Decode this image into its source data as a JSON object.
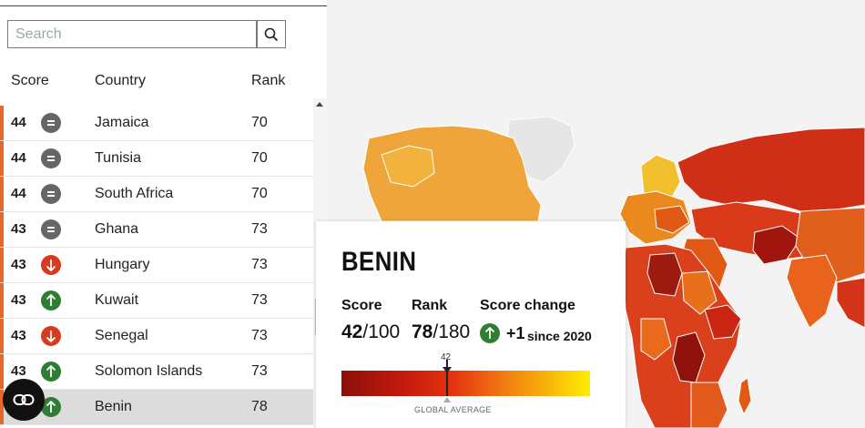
{
  "search": {
    "placeholder": "Search"
  },
  "columns": {
    "score": "Score",
    "country": "Country",
    "rank": "Rank"
  },
  "rows": [
    {
      "score": "44",
      "change": "same",
      "country": "Jamaica",
      "rank": "70"
    },
    {
      "score": "44",
      "change": "same",
      "country": "Tunisia",
      "rank": "70"
    },
    {
      "score": "44",
      "change": "same",
      "country": "South Africa",
      "rank": "70"
    },
    {
      "score": "43",
      "change": "same",
      "country": "Ghana",
      "rank": "73"
    },
    {
      "score": "43",
      "change": "down",
      "country": "Hungary",
      "rank": "73"
    },
    {
      "score": "43",
      "change": "up",
      "country": "Kuwait",
      "rank": "73"
    },
    {
      "score": "43",
      "change": "down",
      "country": "Senegal",
      "rank": "73"
    },
    {
      "score": "43",
      "change": "up",
      "country": "Solomon Islands",
      "rank": "73"
    },
    {
      "score": "",
      "change": "up",
      "country": "Benin",
      "rank": "78",
      "selected": true
    }
  ],
  "colors": {
    "same": "#666666",
    "down": "#d73a1e",
    "up": "#2e7d32",
    "row_bar": "#e8672b"
  },
  "card": {
    "country": "BENIN",
    "score_label": "Score",
    "rank_label": "Rank",
    "change_label": "Score change",
    "score_value": "42",
    "score_total": "/100",
    "rank_value": "78",
    "rank_total": "/180",
    "change_value": "+1",
    "since": "since 2020",
    "marker_value": "42",
    "average_label": "GLOBAL AVERAGE"
  },
  "icons": {
    "search": "search-icon",
    "fab": "link-icon"
  }
}
